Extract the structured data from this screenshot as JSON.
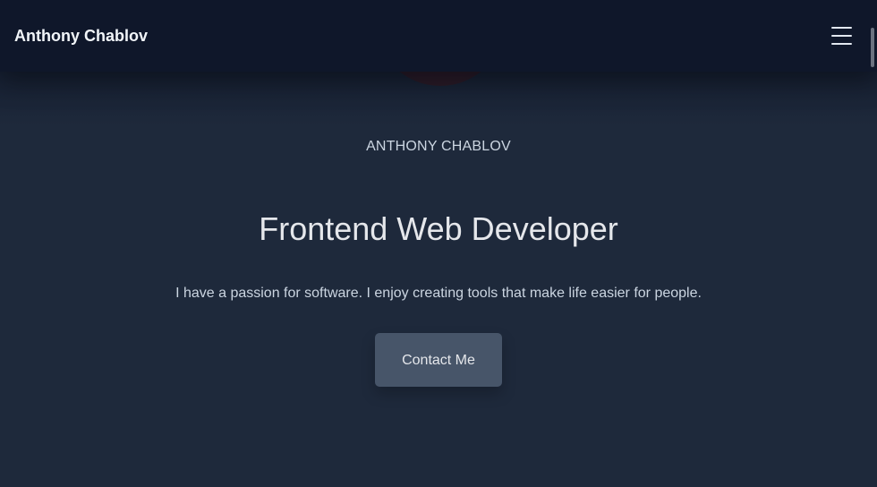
{
  "header": {
    "brand": "Anthony Chablov",
    "menu_icon": "hamburger-menu-icon"
  },
  "hero": {
    "avatar": "profile-avatar",
    "eyebrow": "ANTHONY CHABLOV",
    "title": "Frontend Web Developer",
    "description": "I have a passion for software. I enjoy creating tools that make life easier for people.",
    "cta_label": "Contact Me"
  },
  "colors": {
    "background": "#1e293b",
    "header_background": "#0f172a",
    "button_background": "#475569",
    "text_primary": "#e5e7eb",
    "text_secondary": "#cbd5e1"
  }
}
